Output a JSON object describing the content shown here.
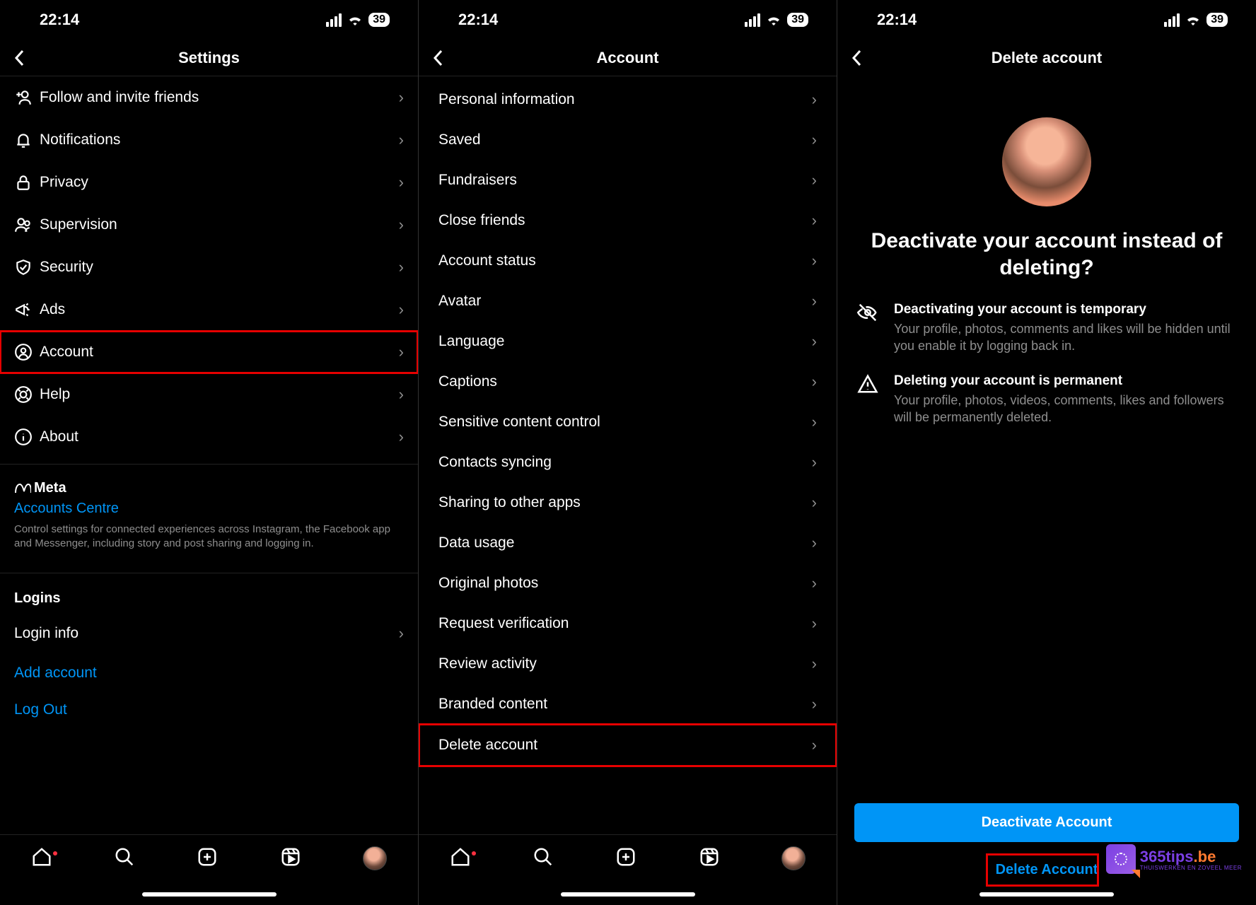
{
  "status": {
    "time": "22:14",
    "battery": "39"
  },
  "panel1": {
    "title": "Settings",
    "items": [
      {
        "icon": "follow",
        "label": "Follow and invite friends"
      },
      {
        "icon": "bell",
        "label": "Notifications"
      },
      {
        "icon": "lock",
        "label": "Privacy"
      },
      {
        "icon": "people",
        "label": "Supervision"
      },
      {
        "icon": "shield",
        "label": "Security"
      },
      {
        "icon": "megaphone",
        "label": "Ads"
      },
      {
        "icon": "account",
        "label": "Account",
        "highlight": true
      },
      {
        "icon": "help",
        "label": "Help"
      },
      {
        "icon": "info",
        "label": "About"
      }
    ],
    "meta_label": "Meta",
    "accounts_centre": "Accounts Centre",
    "meta_desc": "Control settings for connected experiences across Instagram, the Facebook app and Messenger, including story and post sharing and logging in.",
    "logins_heading": "Logins",
    "login_info": "Login info",
    "add_account": "Add account",
    "log_out": "Log Out"
  },
  "panel2": {
    "title": "Account",
    "items": [
      {
        "label": "Personal information"
      },
      {
        "label": "Saved"
      },
      {
        "label": "Fundraisers"
      },
      {
        "label": "Close friends"
      },
      {
        "label": "Account status"
      },
      {
        "label": "Avatar"
      },
      {
        "label": "Language"
      },
      {
        "label": "Captions"
      },
      {
        "label": "Sensitive content control"
      },
      {
        "label": "Contacts syncing"
      },
      {
        "label": "Sharing to other apps"
      },
      {
        "label": "Data usage"
      },
      {
        "label": "Original photos"
      },
      {
        "label": "Request verification"
      },
      {
        "label": "Review activity"
      },
      {
        "label": "Branded content"
      },
      {
        "label": "Delete account",
        "highlight": true
      }
    ]
  },
  "panel3": {
    "title": "Delete account",
    "heading": "Deactivate your account instead of deleting?",
    "info1_title": "Deactivating your account is temporary",
    "info1_desc": "Your profile, photos, comments and likes will be hidden until you enable it by logging back in.",
    "info2_title": "Deleting your account is permanent",
    "info2_desc": "Your profile, photos, videos, comments, likes and followers will be permanently deleted.",
    "btn_deactivate": "Deactivate Account",
    "btn_delete": "Delete Account",
    "watermark": "365tips",
    "watermark_dom": ".be",
    "watermark_sub": "THUISWERKEN EN ZOVEEL MEER"
  }
}
